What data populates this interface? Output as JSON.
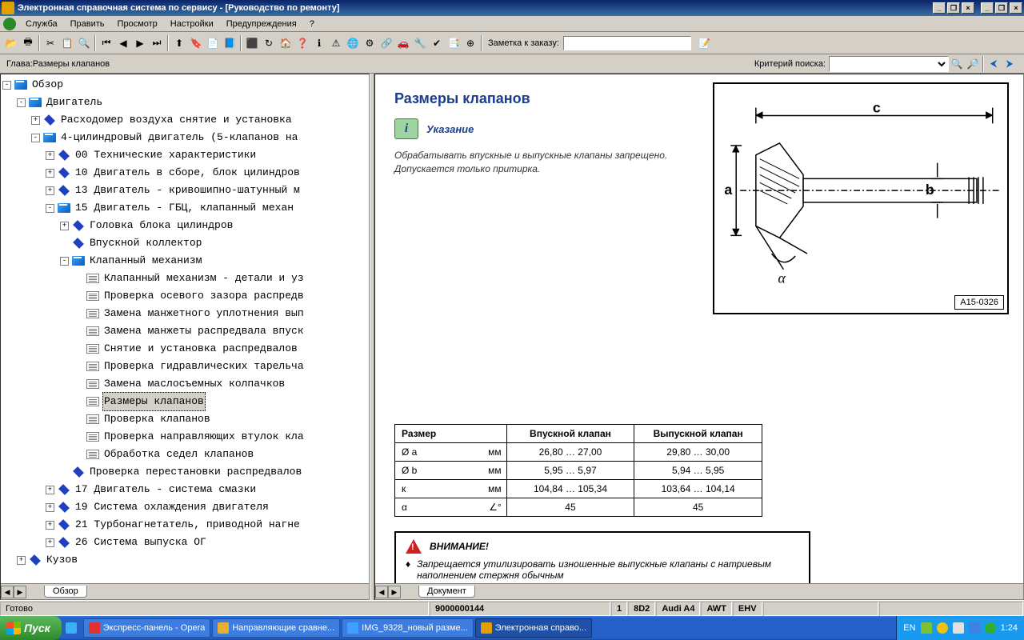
{
  "window": {
    "title": "Электронная справочная система по сервису - [Руководство по ремонту]"
  },
  "menu": [
    "Служба",
    "Править",
    "Просмотр",
    "Настройки",
    "Предупреждения",
    "?"
  ],
  "toolbar": {
    "note_label": "Заметка к заказу:"
  },
  "crit": {
    "chapter_prefix": "Глава:",
    "chapter": "Размеры клапанов",
    "search_label": "Критерий поиска:"
  },
  "tree": [
    {
      "ind": 0,
      "exp": "-",
      "ico": "book",
      "label": "Обзор"
    },
    {
      "ind": 1,
      "exp": "-",
      "ico": "book",
      "label": "Двигатель"
    },
    {
      "ind": 2,
      "exp": "+",
      "ico": "dia",
      "label": "Расходомер воздуха снятие и установка"
    },
    {
      "ind": 2,
      "exp": "-",
      "ico": "book",
      "label": "4-цилиндровый двигатель (5-клапанов на"
    },
    {
      "ind": 3,
      "exp": "+",
      "ico": "dia",
      "label": "00 Технические характеристики"
    },
    {
      "ind": 3,
      "exp": "+",
      "ico": "dia",
      "label": "10 Двигатель в сборе, блок цилиндров"
    },
    {
      "ind": 3,
      "exp": "+",
      "ico": "dia",
      "label": "13 Двигатель - кривошипно-шатунный м"
    },
    {
      "ind": 3,
      "exp": "-",
      "ico": "book",
      "label": "15 Двигатель - ГБЦ, клапанный механ"
    },
    {
      "ind": 4,
      "exp": "+",
      "ico": "dia",
      "label": "Головка блока цилиндров"
    },
    {
      "ind": 4,
      "exp": " ",
      "ico": "dia",
      "label": "Впускной коллектор"
    },
    {
      "ind": 4,
      "exp": "-",
      "ico": "book",
      "label": "Клапанный механизм"
    },
    {
      "ind": 5,
      "exp": " ",
      "ico": "doc",
      "label": "Клапанный механизм - детали и уз"
    },
    {
      "ind": 5,
      "exp": " ",
      "ico": "doc",
      "label": "Проверка осевого зазора распредв"
    },
    {
      "ind": 5,
      "exp": " ",
      "ico": "doc",
      "label": "Замена манжетного уплотнения вып"
    },
    {
      "ind": 5,
      "exp": " ",
      "ico": "doc",
      "label": "Замена манжеты распредвала впуск"
    },
    {
      "ind": 5,
      "exp": " ",
      "ico": "doc",
      "label": "Снятие и установка распредвалов"
    },
    {
      "ind": 5,
      "exp": " ",
      "ico": "doc",
      "label": "Проверка гидравлических тарельча"
    },
    {
      "ind": 5,
      "exp": " ",
      "ico": "doc",
      "label": "Замена маслосъемных колпачков"
    },
    {
      "ind": 5,
      "exp": " ",
      "ico": "doc",
      "label": "Размеры клапанов",
      "selected": true
    },
    {
      "ind": 5,
      "exp": " ",
      "ico": "doc",
      "label": "Проверка клапанов"
    },
    {
      "ind": 5,
      "exp": " ",
      "ico": "doc",
      "label": "Проверка направляющих втулок кла"
    },
    {
      "ind": 5,
      "exp": " ",
      "ico": "doc",
      "label": "Обработка седел клапанов"
    },
    {
      "ind": 4,
      "exp": " ",
      "ico": "dia",
      "label": "Проверка перестановки распредвалов"
    },
    {
      "ind": 3,
      "exp": "+",
      "ico": "dia",
      "label": "17 Двигатель - система смазки"
    },
    {
      "ind": 3,
      "exp": "+",
      "ico": "dia",
      "label": "19 Система охлаждения двигателя"
    },
    {
      "ind": 3,
      "exp": "+",
      "ico": "dia",
      "label": "21 Турбонагнетатель, приводной нагне"
    },
    {
      "ind": 3,
      "exp": "+",
      "ico": "dia",
      "label": "26 Система выпуска ОГ"
    },
    {
      "ind": 1,
      "exp": "+",
      "ico": "dia",
      "label": "Кузов"
    }
  ],
  "left_tab": "Обзор",
  "right_tab": "Документ",
  "content": {
    "title": "Размеры клапанов",
    "hint": "Указание",
    "body1": "Обрабатывать впускные и выпускные клапаны запрещено.",
    "body2": "Допускается только притирка.",
    "diagram_ref": "A15-0326",
    "diag_labels": {
      "a": "a",
      "b": "b",
      "c": "c",
      "alpha": "α"
    },
    "table": {
      "h1": "Размер",
      "h2": "Впускной клапан",
      "h3": "Выпускной клапан",
      "rows": [
        {
          "p": "Ø a",
          "u": "мм",
          "v1": "26,80 … 27,00",
          "v2": "29,80 … 30,00"
        },
        {
          "p": "Ø b",
          "u": "мм",
          "v1": "5,95 … 5,97",
          "v2": "5,94 … 5,95"
        },
        {
          "p": "к",
          "u": "мм",
          "v1": "104,84 … 105,34",
          "v2": "103,64 … 104,14"
        },
        {
          "p": "α",
          "u": "∠°",
          "v1": "45",
          "v2": "45"
        }
      ]
    },
    "warn_title": "ВНИМАНИЕ!",
    "warn_body": "Запрещается утилизировать изношенные выпускные клапаны с натриевым наполнением стержня обычным"
  },
  "status": {
    "ready": "Готово",
    "doc": "9000000144",
    "n": "1",
    "code1": "8D2",
    "model": "Audi A4",
    "code2": "AWT",
    "code3": "EHV"
  },
  "taskbar": {
    "start": "Пуск",
    "items": [
      "Экспресс-панель - Opera",
      "Направляющие сравне...",
      "IMG_9328_новый разме...",
      "Электронная справо..."
    ],
    "lang": "EN",
    "time": "1:24"
  }
}
